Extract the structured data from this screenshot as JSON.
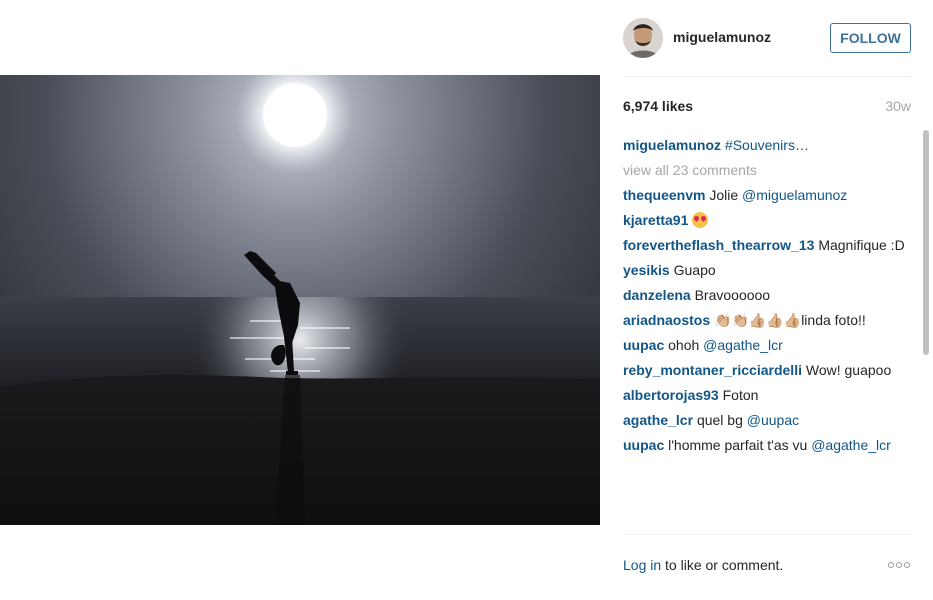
{
  "post": {
    "username": "miguelamunoz",
    "follow_label": "FOLLOW",
    "likes": "6,974 likes",
    "age": "30w"
  },
  "caption": {
    "user": "miguelamunoz",
    "text": "#Souvenirs…"
  },
  "view_all": "view all 23 comments",
  "comments": [
    {
      "user": "thequeenvm",
      "text": "Jolie ",
      "mention": "@miguelamunoz"
    },
    {
      "user": "kjaretta91",
      "emoji": "heart-eyes-emoji"
    },
    {
      "user": "forevertheflash_thearrow_13",
      "text": "Magnifique :D"
    },
    {
      "user": "yesikis",
      "text": "Guapo"
    },
    {
      "user": "danzelena",
      "text": "Bravoooooo"
    },
    {
      "user": "ariadnaostos",
      "text": "👏🏼👏🏼👍🏼👍🏼👍🏼linda foto!!"
    },
    {
      "user": "uupac",
      "text": "ohoh ",
      "mention": "@agathe_lcr"
    },
    {
      "user": "reby_montaner_ricciardelli",
      "text": "Wow! guapoo"
    },
    {
      "user": "albertorojas93",
      "text": "Foton"
    },
    {
      "user": "agathe_lcr",
      "text": "quel bg ",
      "mention": "@uupac"
    },
    {
      "user": "uupac",
      "text": "l'homme parfait t'as vu ",
      "mention": "@agathe_lcr"
    }
  ],
  "footer": {
    "login_link": "Log in",
    "login_text": " to like or comment."
  },
  "icons": {
    "more": "more-options-icon"
  },
  "colors": {
    "link": "#125688",
    "follow": "#3f729b",
    "muted": "#a5a7aa"
  }
}
